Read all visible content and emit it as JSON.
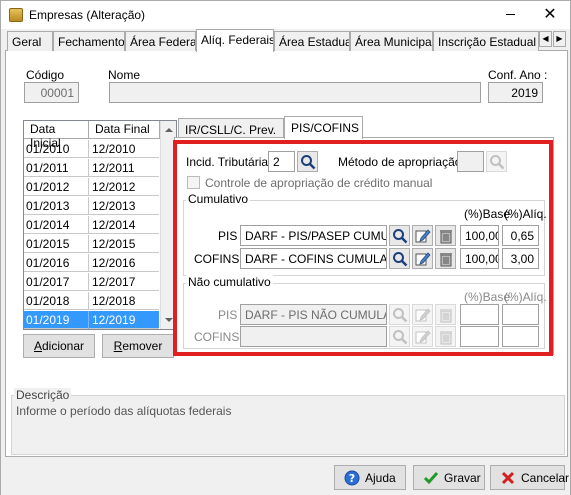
{
  "window": {
    "title": "Empresas (Alteração)",
    "minimize_glyph": "",
    "close_glyph": "✕"
  },
  "tabs": [
    {
      "label": "Geral",
      "active": false
    },
    {
      "label": "Fechamento",
      "active": false
    },
    {
      "label": "Área Federal",
      "active": false
    },
    {
      "label": "Alíq. Federais",
      "active": true
    },
    {
      "label": "Área Estadual",
      "active": false
    },
    {
      "label": "Área Municipal",
      "active": false
    },
    {
      "label": "Inscrição Estadual S",
      "active": false
    }
  ],
  "tab_scroll": {
    "left": "◀",
    "right": "▶"
  },
  "header": {
    "codigo_label": "Código",
    "codigo_value": "00001",
    "nome_label": "Nome",
    "nome_value": "",
    "conf_ano_label": "Conf. Ano :",
    "conf_ano_value": "2019"
  },
  "period_list": {
    "columns": [
      "Data Inicial",
      "Data Final"
    ],
    "rows": [
      {
        "inicial": "01/2010",
        "final": "12/2010"
      },
      {
        "inicial": "01/2011",
        "final": "12/2011"
      },
      {
        "inicial": "01/2012",
        "final": "12/2012"
      },
      {
        "inicial": "01/2013",
        "final": "12/2013"
      },
      {
        "inicial": "01/2014",
        "final": "12/2014"
      },
      {
        "inicial": "01/2015",
        "final": "12/2015"
      },
      {
        "inicial": "01/2016",
        "final": "12/2016"
      },
      {
        "inicial": "01/2017",
        "final": "12/2017"
      },
      {
        "inicial": "01/2018",
        "final": "12/2018"
      },
      {
        "inicial": "01/2019",
        "final": "12/2019"
      }
    ],
    "selected_index": 9,
    "add_label": "Adicionar",
    "add_underline": "A",
    "remove_label": "Remover",
    "remove_underline": "R"
  },
  "inner_tabs": [
    {
      "label": "IR/CSLL/C. Prev.",
      "active": false
    },
    {
      "label": "PIS/COFINS",
      "active": true
    }
  ],
  "pis_cofins": {
    "incid_label": "Incid. Tributária:",
    "incid_value": "2",
    "metodo_label": "Método de apropriação:",
    "metodo_value": "",
    "controle_label": "Controle de apropriação de crédito manual",
    "cumulativo": {
      "title": "Cumulativo",
      "base_header": "(%)Base",
      "aliq_header": "(%)Alíq.",
      "pis_label": "PIS",
      "pis_darf": "DARF - PIS/PASEP CUMULATIVO",
      "pis_base": "100,00",
      "pis_aliq": "0,65",
      "cofins_label": "COFINS",
      "cofins_darf": "DARF - COFINS CUMULATIVO",
      "cofins_base": "100,00",
      "cofins_aliq": "3,00"
    },
    "nao_cumulativo": {
      "title": "Não cumulativo",
      "base_header": "(%)Base",
      "aliq_header": "(%)Alíq.",
      "pis_label": "PIS",
      "pis_darf": "DARF - PIS NÃO CUMULATIVO",
      "pis_base": "",
      "pis_aliq": "",
      "cofins_label": "COFINS",
      "cofins_darf": "",
      "cofins_base": "",
      "cofins_aliq": ""
    }
  },
  "description": {
    "title": "Descrição",
    "text": "Informe o período das alíquotas federais"
  },
  "buttons": {
    "ajuda": "Ajuda",
    "gravar": "Gravar",
    "cancelar": "Cancelar"
  },
  "colors": {
    "highlight": "#e02020",
    "selection": "#3399ff"
  }
}
